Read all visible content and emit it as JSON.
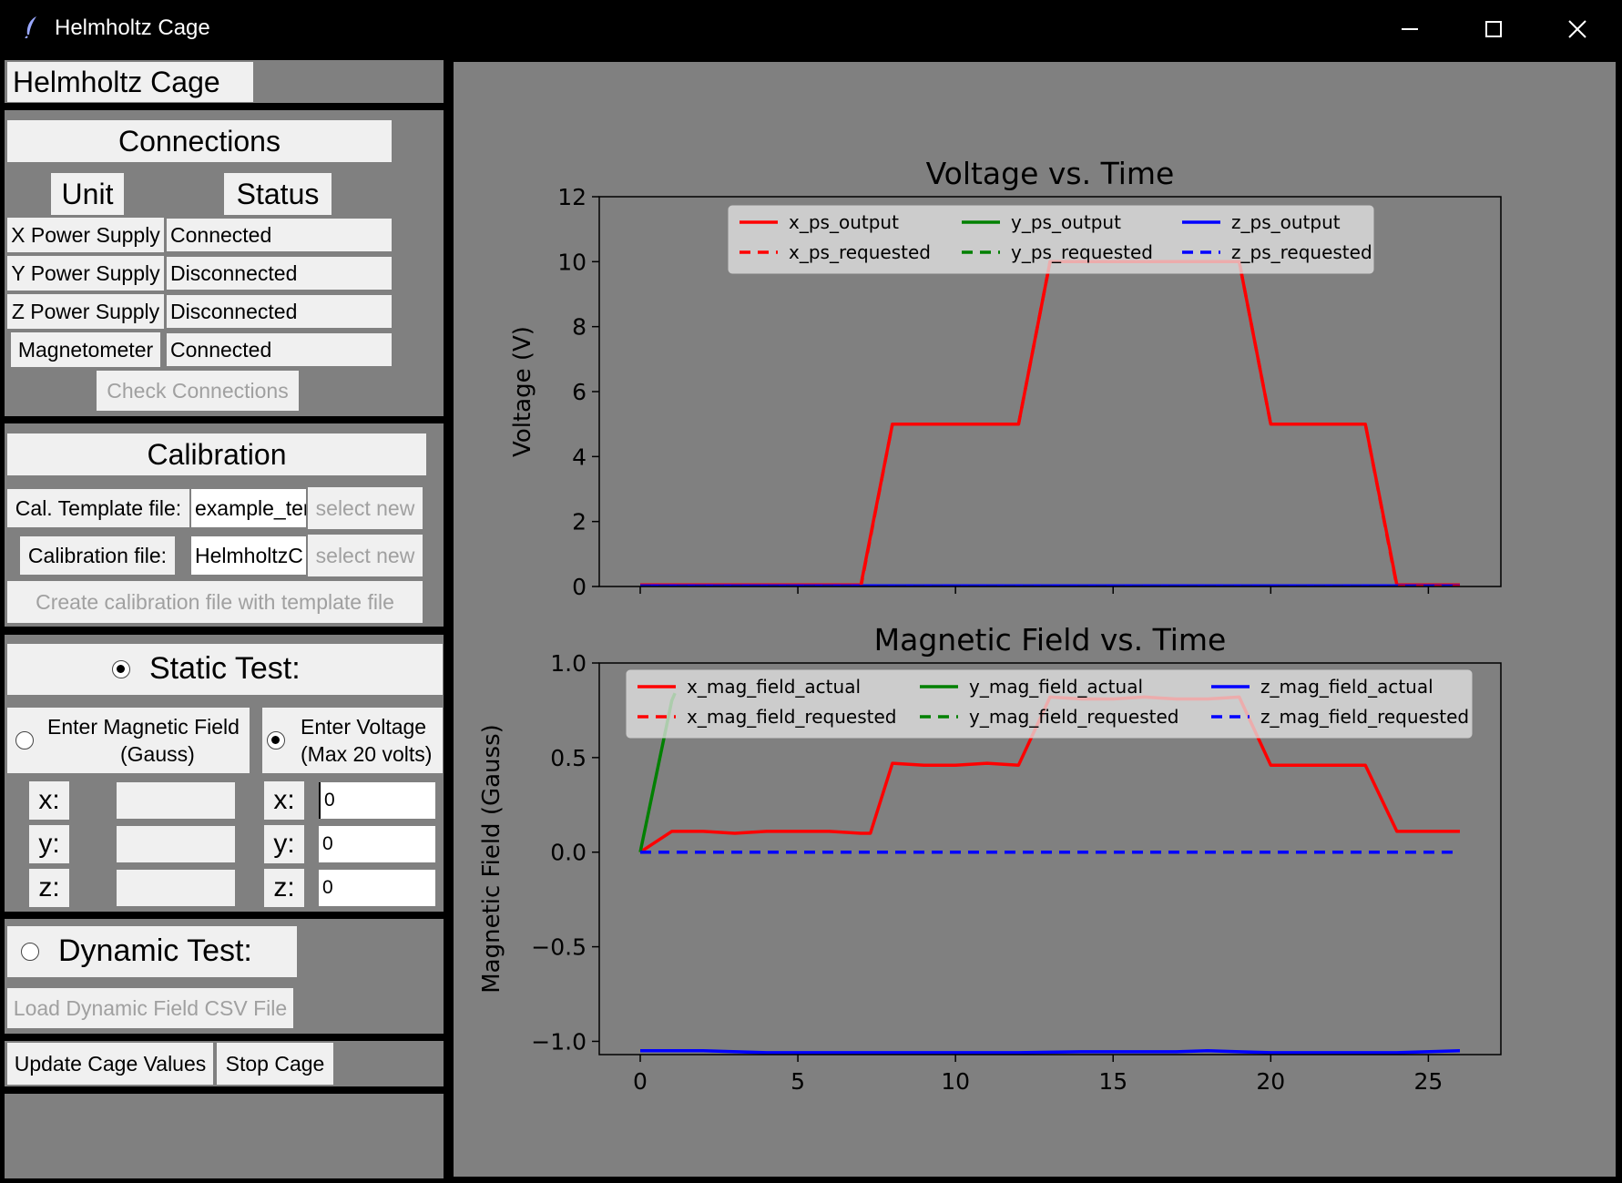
{
  "window": {
    "title": "Helmholtz Cage"
  },
  "app_header": {
    "title": "Helmholtz Cage"
  },
  "connections": {
    "heading": "Connections",
    "col_unit": "Unit",
    "col_status": "Status",
    "rows": [
      {
        "unit": "X Power Supply",
        "status": "Connected"
      },
      {
        "unit": "Y Power Supply",
        "status": "Disconnected"
      },
      {
        "unit": "Z Power Supply",
        "status": "Disconnected"
      },
      {
        "unit": "Magnetometer",
        "status": "Connected"
      }
    ],
    "check_button": "Check Connections"
  },
  "calibration": {
    "heading": "Calibration",
    "template_label": "Cal. Template file:",
    "template_value": "example_ter",
    "calibration_label": "Calibration file:",
    "calibration_value": "HelmholtzC",
    "select_new_1": "select new",
    "select_new_2": "select new",
    "create_button": "Create calibration file with template file"
  },
  "static_test": {
    "label": "Static Test:",
    "selected": true,
    "magnetic_option": {
      "line1": "Enter Magnetic Field",
      "line2": "(Gauss)",
      "selected": false
    },
    "voltage_option": {
      "line1": "Enter Voltage",
      "line2": "(Max 20 volts)",
      "selected": true
    },
    "axis_labels": [
      "x:",
      "y:",
      "z:"
    ],
    "field_values": [
      "",
      "",
      ""
    ],
    "voltage_values": [
      "0",
      "0",
      "0"
    ]
  },
  "dynamic_test": {
    "label": "Dynamic Test:",
    "selected": false,
    "load_button": "Load Dynamic Field CSV File"
  },
  "actions": {
    "update_button": "Update Cage Values",
    "stop_button": "Stop Cage"
  },
  "colors": {
    "x": "#ff0000",
    "y": "#008000",
    "z": "#0000ff",
    "panel": "#808080",
    "widget": "#f0f0f0"
  },
  "chart_data": [
    {
      "type": "line",
      "title": "Voltage vs. Time",
      "xlabel": "",
      "ylabel": "Voltage (V)",
      "xlim": [
        -1.3,
        27.3
      ],
      "ylim": [
        0,
        12
      ],
      "xticks": [
        0,
        5,
        10,
        15,
        20,
        25
      ],
      "yticks": [
        0,
        2,
        4,
        6,
        8,
        10,
        12
      ],
      "show_xtick_labels": false,
      "legend": {
        "position": "top-center",
        "columns": 3
      },
      "series": [
        {
          "name": "x_ps_output",
          "axis": "x",
          "style": "solid",
          "x": [
            0,
            7,
            8,
            12,
            13,
            19,
            20,
            23,
            24,
            26
          ],
          "y": [
            0.05,
            0.05,
            5,
            5,
            10,
            10,
            5,
            5,
            0.05,
            0.05
          ]
        },
        {
          "name": "x_ps_requested",
          "axis": "x",
          "style": "dashed",
          "x": [
            0,
            7,
            8,
            12,
            13,
            19,
            20,
            23,
            24,
            26
          ],
          "y": [
            0,
            0,
            5,
            5,
            10,
            10,
            5,
            5,
            0,
            0
          ]
        },
        {
          "name": "y_ps_output",
          "axis": "y",
          "style": "solid",
          "x": [
            0,
            26
          ],
          "y": [
            0,
            0
          ]
        },
        {
          "name": "y_ps_requested",
          "axis": "y",
          "style": "dashed",
          "x": [
            0,
            26
          ],
          "y": [
            0,
            0
          ]
        },
        {
          "name": "z_ps_output",
          "axis": "z",
          "style": "solid",
          "x": [
            0,
            26
          ],
          "y": [
            0.02,
            0.02
          ]
        },
        {
          "name": "z_ps_requested",
          "axis": "z",
          "style": "dashed",
          "x": [
            0,
            26
          ],
          "y": [
            0,
            0
          ]
        }
      ]
    },
    {
      "type": "line",
      "title": "Magnetic Field vs. Time",
      "xlabel": "",
      "ylabel": "Magnetic Field (Gauss)",
      "xlim": [
        -1.3,
        27.3
      ],
      "ylim": [
        -1.07,
        1.0
      ],
      "xticks": [
        0,
        5,
        10,
        15,
        20,
        25
      ],
      "yticks": [
        -1.0,
        -0.5,
        0.0,
        0.5,
        1.0
      ],
      "ytick_labels": [
        "−1.0",
        "−0.5",
        "0.0",
        "0.5",
        "1.0"
      ],
      "show_xtick_labels": true,
      "legend": {
        "position": "top-center",
        "columns": 3
      },
      "series": [
        {
          "name": "x_mag_field_actual",
          "axis": "x",
          "style": "solid",
          "x": [
            0,
            1,
            2,
            3,
            4,
            5,
            6,
            7,
            7.3,
            8,
            9,
            10,
            11,
            12,
            13,
            14,
            15,
            16,
            17,
            18,
            19,
            20,
            21,
            22,
            23,
            24,
            25,
            26
          ],
          "y": [
            0,
            0.11,
            0.11,
            0.1,
            0.11,
            0.11,
            0.11,
            0.1,
            0.1,
            0.47,
            0.46,
            0.46,
            0.47,
            0.46,
            0.82,
            0.81,
            0.81,
            0.82,
            0.81,
            0.81,
            0.82,
            0.46,
            0.46,
            0.46,
            0.46,
            0.11,
            0.11,
            0.11
          ]
        },
        {
          "name": "x_mag_field_requested",
          "axis": "x",
          "style": "dashed",
          "x": [
            0,
            26
          ],
          "y": [
            0,
            0
          ]
        },
        {
          "name": "y_mag_field_actual",
          "axis": "y",
          "style": "solid",
          "x": [
            0,
            1,
            1.1
          ],
          "y": [
            0,
            0.8,
            0.84
          ]
        },
        {
          "name": "y_mag_field_requested",
          "axis": "y",
          "style": "dashed",
          "x": [
            0,
            26
          ],
          "y": [
            0,
            0
          ]
        },
        {
          "name": "z_mag_field_actual",
          "axis": "z",
          "style": "solid",
          "x": [
            0,
            2,
            4,
            6,
            8,
            10,
            12,
            14,
            16,
            17,
            18,
            19,
            20,
            22,
            24,
            26
          ],
          "y": [
            -1.05,
            -1.05,
            -1.06,
            -1.06,
            -1.06,
            -1.06,
            -1.06,
            -1.055,
            -1.055,
            -1.055,
            -1.05,
            -1.055,
            -1.06,
            -1.06,
            -1.06,
            -1.05
          ]
        },
        {
          "name": "z_mag_field_requested",
          "axis": "z",
          "style": "dashed",
          "x": [
            0,
            26
          ],
          "y": [
            0,
            0
          ]
        }
      ]
    }
  ]
}
